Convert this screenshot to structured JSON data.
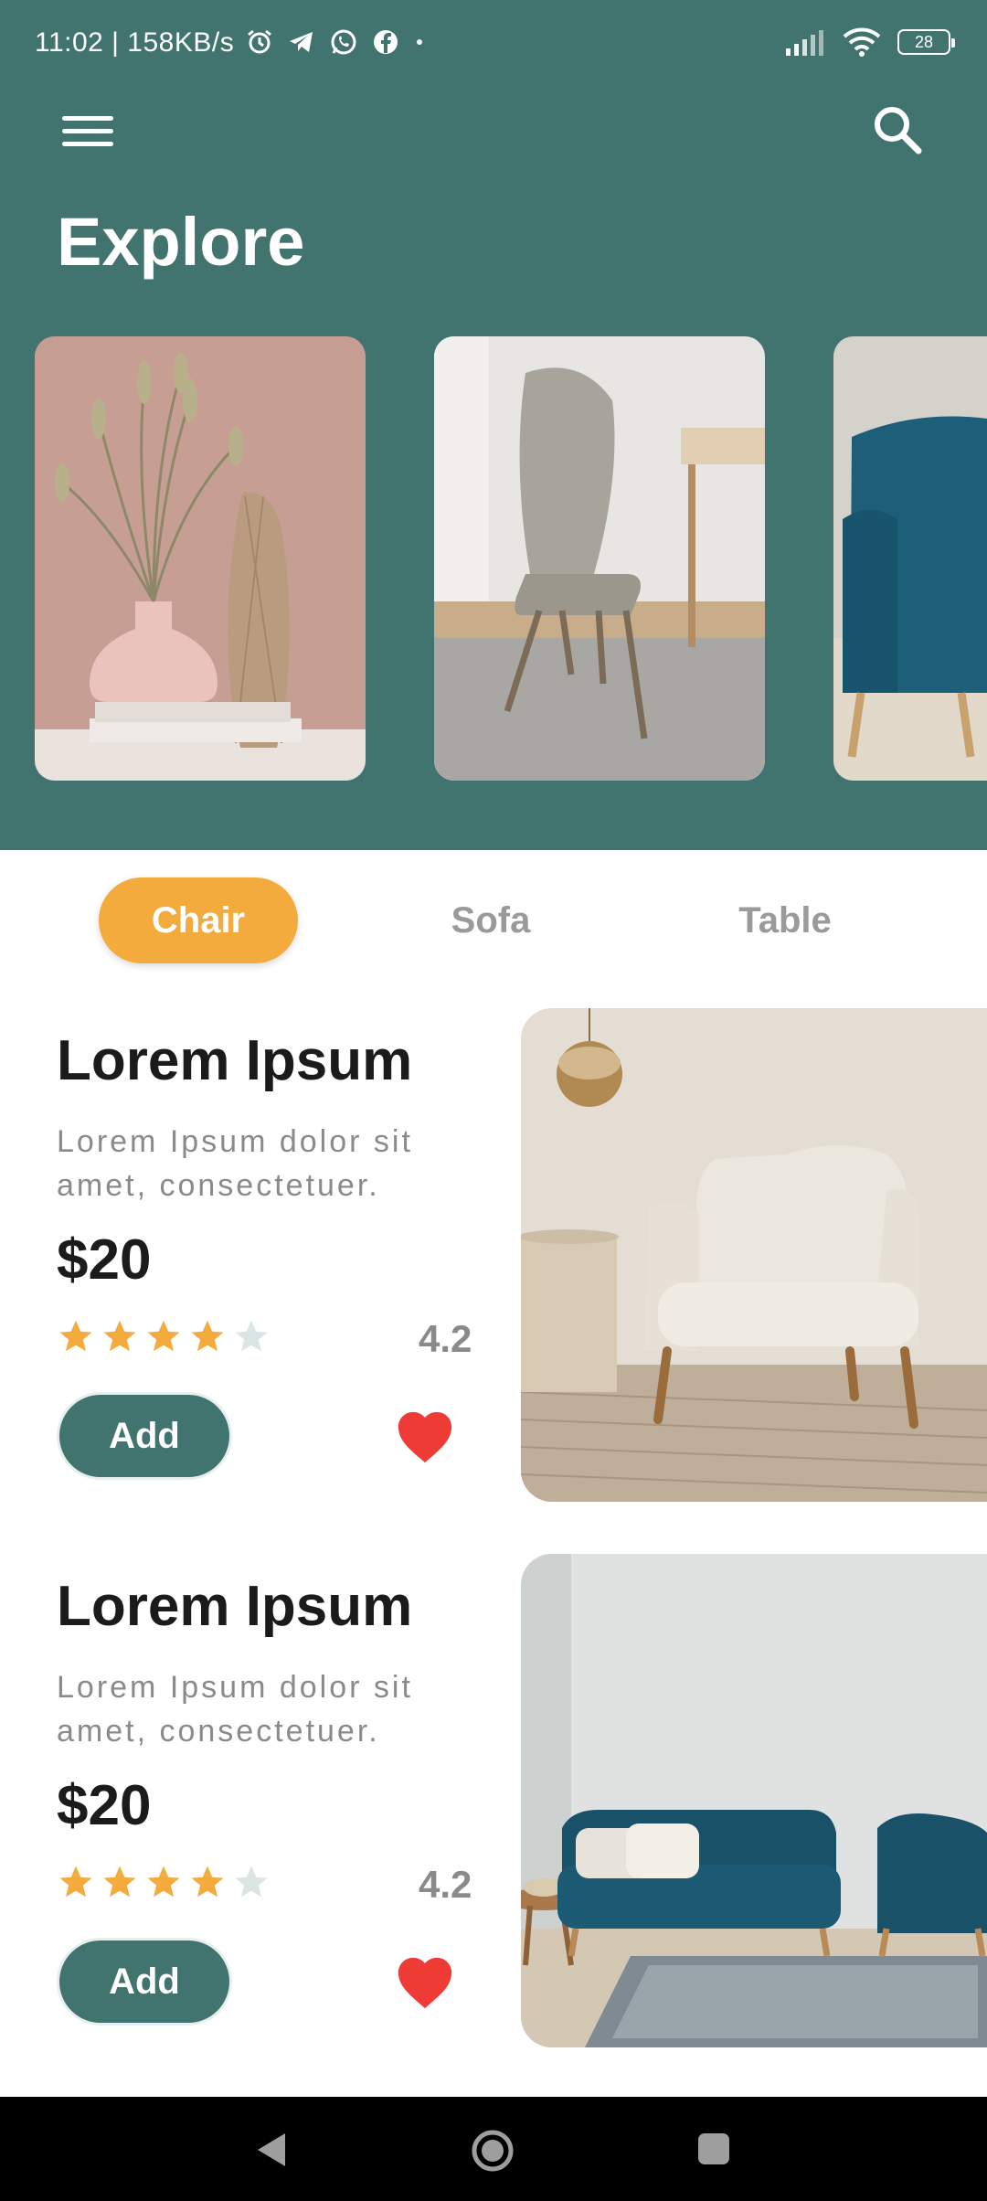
{
  "status_bar": {
    "time": "11:02 | 158KB/s",
    "battery": "28",
    "icons": [
      "alarm-icon",
      "telegram-icon",
      "whatsapp-icon",
      "facebook-icon",
      "dot-icon",
      "signal-icon",
      "wifi-icon",
      "battery-icon"
    ]
  },
  "header": {
    "title": "Explore",
    "menu_icon": "hamburger-menu-icon",
    "search_icon": "search-icon",
    "background_color": "#41736f"
  },
  "carousel": {
    "cards": [
      {
        "name": "vase-decor-card"
      },
      {
        "name": "grey-chair-card"
      },
      {
        "name": "blue-armchair-card"
      }
    ]
  },
  "tabs": {
    "items": [
      {
        "label": "Chair",
        "active": true
      },
      {
        "label": "Sofa",
        "active": false
      },
      {
        "label": "Table",
        "active": false
      }
    ],
    "active_color": "#f4ab3e"
  },
  "products": [
    {
      "name": "Lorem Ipsum",
      "description": "Lorem Ipsum dolor sit amet, consectetuer.",
      "price": "$20",
      "rating": "4.2",
      "stars_filled": 4,
      "add_label": "Add",
      "favorite": true,
      "image": "cream-armchair-photo"
    },
    {
      "name": "Lorem Ipsum",
      "description": "Lorem Ipsum dolor sit amet, consectetuer.",
      "price": "$20",
      "rating": "4.2",
      "stars_filled": 4,
      "add_label": "Add",
      "favorite": true,
      "image": "blue-sofa-photo"
    }
  ],
  "colors": {
    "accent": "#41736f",
    "star": "#f4ab3e",
    "heart": "#ef3b36"
  },
  "nav_bar": {
    "icons": [
      "back-icon",
      "home-icon",
      "recents-icon"
    ]
  }
}
